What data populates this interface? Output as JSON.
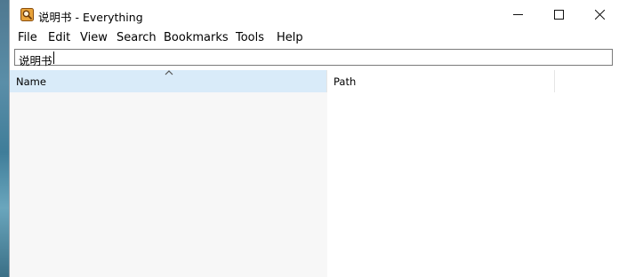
{
  "window": {
    "title": "说明书 - Everything"
  },
  "menu": {
    "items": [
      {
        "label": "File"
      },
      {
        "label": "Edit"
      },
      {
        "label": "View"
      },
      {
        "label": "Search"
      },
      {
        "label": "Bookmarks"
      },
      {
        "label": "Tools"
      },
      {
        "label": "Help"
      }
    ]
  },
  "search": {
    "value": "说明书"
  },
  "columns": {
    "name": "Name",
    "path": "Path"
  },
  "colors": {
    "name_column_header": "#d9ebf9",
    "name_column_fill": "#f7f7f7"
  }
}
